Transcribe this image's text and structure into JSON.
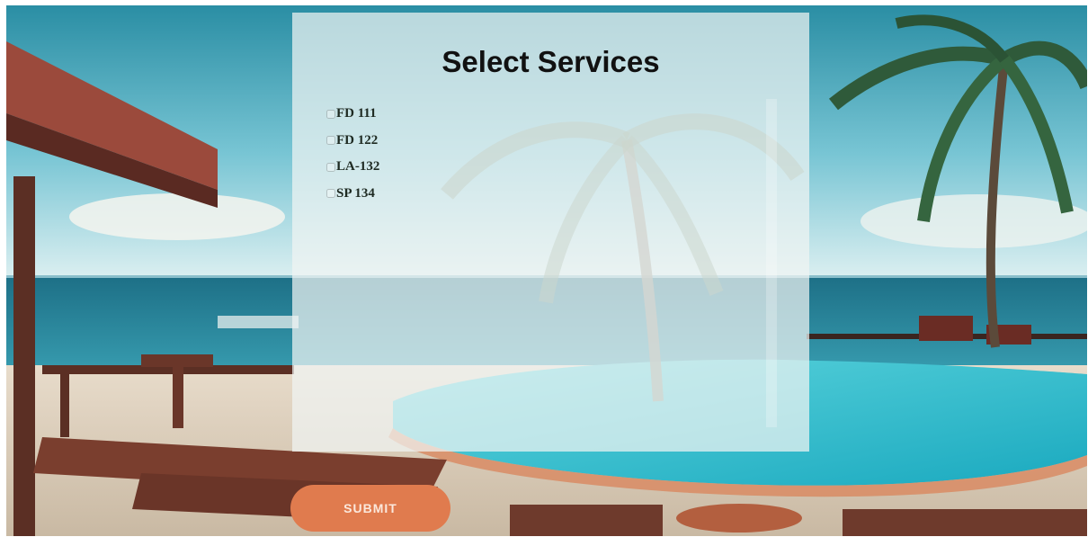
{
  "panel": {
    "title": "Select Services",
    "services": [
      {
        "label": "FD 111",
        "checked": false
      },
      {
        "label": "FD 122",
        "checked": false
      },
      {
        "label": "LA-132",
        "checked": false
      },
      {
        "label": "SP 134",
        "checked": false
      }
    ]
  },
  "actions": {
    "submit_label": "SUBMIT"
  },
  "colors": {
    "submit": "#e07b4e",
    "panel_overlay": "rgba(240,244,242,0.72)"
  }
}
